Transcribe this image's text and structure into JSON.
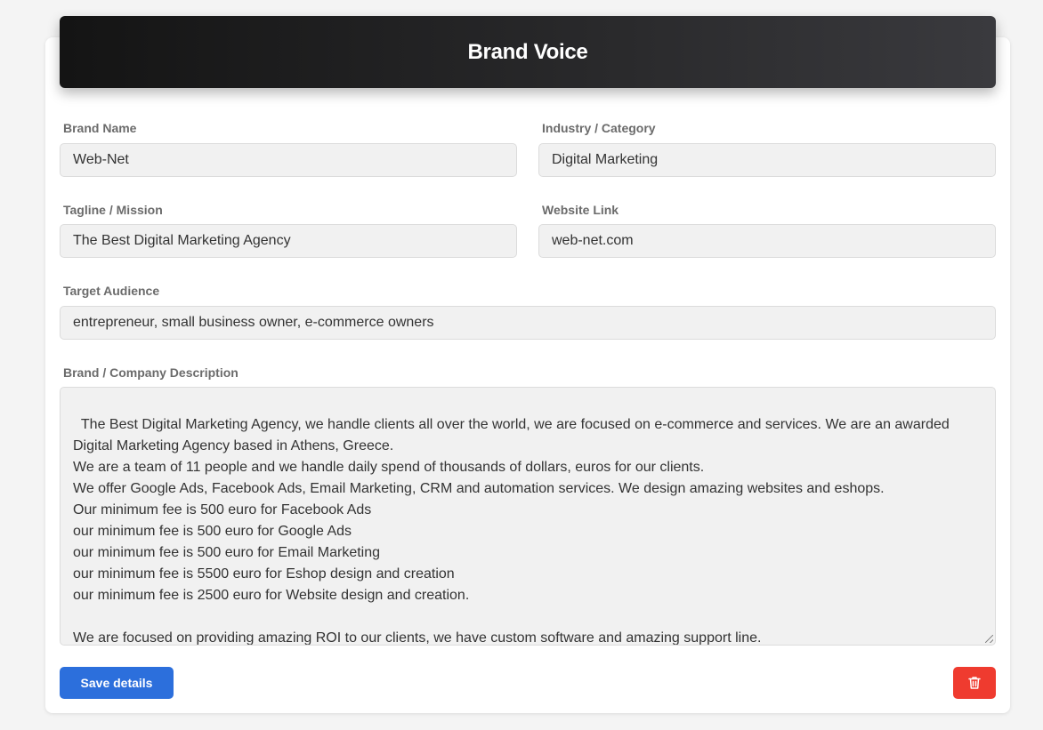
{
  "header": {
    "title": "Brand Voice"
  },
  "fields": {
    "brand_name": {
      "label": "Brand Name",
      "value": "Web-Net"
    },
    "industry": {
      "label": "Industry / Category",
      "value": "Digital Marketing"
    },
    "tagline": {
      "label": "Tagline / Mission",
      "value": "The Best Digital Marketing Agency"
    },
    "website": {
      "label": "Website Link",
      "value": "web-net.com"
    },
    "audience": {
      "label": "Target Audience",
      "value": "entrepreneur, small business owner, e-commerce owners"
    },
    "description": {
      "label": "Brand / Company Description",
      "value": "The Best Digital Marketing Agency, we handle clients all over the world, we are focused on e-commerce and services. We are an awarded Digital Marketing Agency based in Athens, Greece.\nWe are a team of 11 people and we handle daily spend of thousands of dollars, euros for our clients.\nWe offer Google Ads, Facebook Ads, Email Marketing, CRM and automation services. We design amazing websites and eshops.\nOur minimum fee is 500 euro for Facebook Ads\nour minimum fee is 500 euro for Google Ads\nour minimum fee is 500 euro for Email Marketing\nour minimum fee is 5500 euro for Eshop design and creation\nour minimum fee is 2500 euro for Website design and creation.\n\nWe are focused on providing amazing ROI to our clients, we have custom software and amazing support line."
    }
  },
  "actions": {
    "save_label": "Save details",
    "delete_icon": "trash-icon"
  },
  "colors": {
    "primary": "#2c6fdc",
    "danger": "#ef3b2f",
    "header_bg": "#1c1c1e"
  }
}
